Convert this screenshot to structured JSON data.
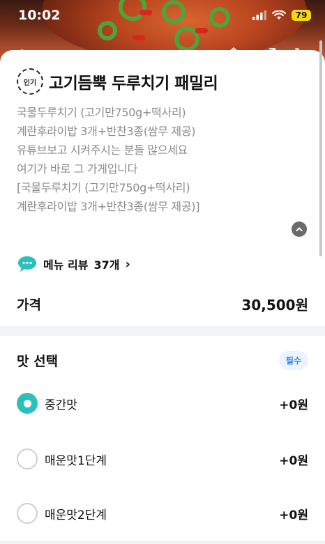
{
  "status_bar": {
    "time": "10:02",
    "battery": "79"
  },
  "menu": {
    "badge": "인기",
    "title": "고기듬뿍 두루치기 패밀리",
    "description_lines": [
      "국물두루치기 (고기만750g+떡사리)",
      "계란후라이밥 3개+반찬3종(쌈무 제공)",
      "유튜브보고 시켜주시는 분들 많으세요",
      "여기가 바로 그 가게입니다",
      "[국물두루치기 (고기만750g+떡사리)",
      "계란후라이밥 3개+반찬3종(쌈무 제공)]"
    ],
    "review": {
      "label": "메뉴 리뷰",
      "count": "37개",
      "chevron": "›"
    },
    "price": {
      "label": "가격",
      "value": "30,500원"
    }
  },
  "options": {
    "title": "맛 선택",
    "required_label": "필수",
    "items": [
      {
        "name": "중간맛",
        "price": "+0원",
        "selected": true
      },
      {
        "name": "매운맛1단계",
        "price": "+0원",
        "selected": false
      },
      {
        "name": "매운맛2단계",
        "price": "+0원",
        "selected": false
      }
    ]
  },
  "icons": {
    "back": "arrow-left-icon",
    "home": "home-icon",
    "share": "share-icon",
    "cart": "cart-icon",
    "review": "speech-bubble-icon",
    "collapse": "chevron-up-icon"
  },
  "colors": {
    "accent": "#2ac1bc",
    "required_badge_text": "#2f7fe0",
    "muted_text": "#8b8b8b"
  }
}
